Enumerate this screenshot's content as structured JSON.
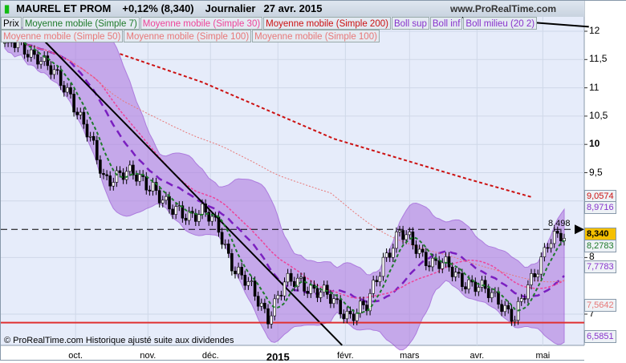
{
  "header": {
    "instrument": "MAUREL ET PROM",
    "change": "+0,12% (8,340)",
    "period": "Journalier",
    "date": "27 avr. 2015"
  },
  "legend_row1": [
    {
      "label": "Prix",
      "color": "#000000"
    },
    {
      "label": "Moyenne mobile (Simple 7)",
      "color": "#1e7a2a"
    },
    {
      "label": "Moyenne mobile (Simple 30)",
      "color": "#ee4499"
    },
    {
      "label": "Moyenne mobile (Simple 200)",
      "color": "#cc1111"
    },
    {
      "label": "Boll sup",
      "color": "#8833cc"
    },
    {
      "label": "Boll inf",
      "color": "#8833cc"
    },
    {
      "label": "Boll milieu (20 2)",
      "color": "#8833cc"
    }
  ],
  "legend_row2": [
    {
      "label": "Moyenne mobile (Simple 50)",
      "color": "#e87878"
    },
    {
      "label": "Moyenne mobile (Simple 100)",
      "color": "#e87878"
    },
    {
      "label": "Moyenne mobile (Simple 100)",
      "color": "#e87878"
    }
  ],
  "footer": "© ProRealTime.com  Historique ajusté suite aux dividendes",
  "watermark": "www.ProRealTime.com",
  "chart_data": {
    "type": "candlestick",
    "title": "MAUREL ET PROM - Journalier",
    "ylim": [
      6.4,
      12.35
    ],
    "yticks": [
      "12",
      "11,5",
      "11",
      "10,5",
      "10",
      "9,5",
      "9",
      "8",
      "7"
    ],
    "xticks": [
      {
        "label": "oct.",
        "week": 4.3
      },
      {
        "label": "nov.",
        "week": 8.7
      },
      {
        "label": "déc.",
        "week": 12.5
      },
      {
        "label": "2015",
        "week": 16.6,
        "bold": true
      },
      {
        "label": "févr.",
        "week": 20.7
      },
      {
        "label": "mars",
        "week": 24.6
      },
      {
        "label": "avr.",
        "week": 28.7
      },
      {
        "label": "mai",
        "week": 32.7
      }
    ],
    "weeks_span": 36,
    "weekly_close": [
      11.8,
      11.7,
      11.6,
      11.2,
      10.9,
      10.2,
      9.4,
      9.5,
      9.4,
      9.3,
      8.8,
      8.8,
      8.8,
      8.5,
      7.8,
      7.4,
      7.0,
      7.5,
      7.6,
      7.4,
      7.2,
      7.0,
      7.1,
      8.0,
      8.4,
      8.2,
      7.9,
      7.8,
      7.6,
      7.4,
      7.3,
      6.9,
      7.6,
      8.3,
      8.34
    ],
    "ma200": [
      [
        7,
        11.6
      ],
      [
        12,
        11.1
      ],
      [
        20,
        10.1
      ],
      [
        28,
        9.4
      ],
      [
        32,
        9.07
      ]
    ],
    "resistance": 8.498,
    "support": 6.85,
    "trendline": [
      [
        2.4,
        11.83
      ],
      [
        20.5,
        6.45
      ]
    ],
    "top_line": [
      [
        21,
        12.4
      ],
      [
        35.5,
        12.08
      ]
    ],
    "value_boxes": [
      {
        "value": "9,0574",
        "color": "#cc1111"
      },
      {
        "value": "8,9716",
        "color": "#8833cc"
      },
      {
        "value": "8,340",
        "color": "#000000",
        "highlight": true
      },
      {
        "value": "8,2783",
        "color": "#1e7a2a"
      },
      {
        "value": "7,7783",
        "color": "#8833cc"
      },
      {
        "value": "7,5642",
        "color": "#e87878"
      },
      {
        "value": "6,5851",
        "color": "#8833cc"
      }
    ],
    "resistance_label": "8,498"
  }
}
